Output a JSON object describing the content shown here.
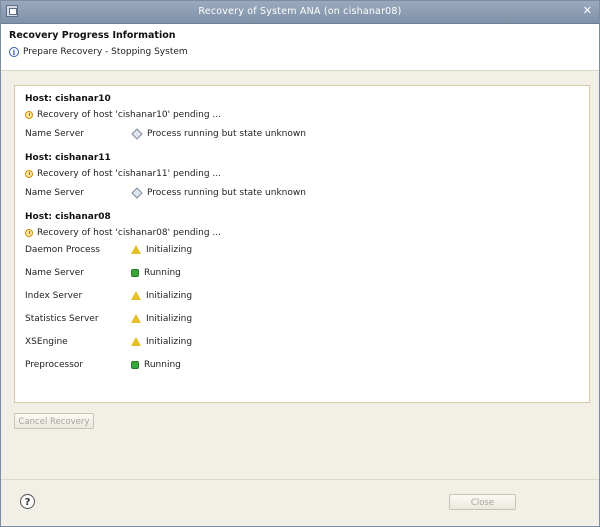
{
  "window": {
    "title": "Recovery of System ANA  (on cishanar08)"
  },
  "header": {
    "title": "Recovery Progress Information",
    "status": "Prepare Recovery - Stopping System"
  },
  "hosts": [
    {
      "title": "Host: cishanar10",
      "pending": "Recovery of host 'cishanar10' pending ...",
      "components": [
        {
          "name": "Name Server",
          "status": "Process running but state unknown",
          "icon": "diamond-icon"
        }
      ]
    },
    {
      "title": "Host: cishanar11",
      "pending": "Recovery of host 'cishanar11' pending ...",
      "components": [
        {
          "name": "Name Server",
          "status": "Process running but state unknown",
          "icon": "diamond-icon"
        }
      ]
    },
    {
      "title": "Host: cishanar08",
      "pending": "Recovery of host 'cishanar08' pending ...",
      "components": [
        {
          "name": "Daemon Process",
          "status": "Initializing",
          "icon": "warning-icon"
        },
        {
          "name": "Name Server",
          "status": "Running",
          "icon": "running-icon"
        },
        {
          "name": "Index Server",
          "status": "Initializing",
          "icon": "warning-icon"
        },
        {
          "name": "Statistics Server",
          "status": "Initializing",
          "icon": "warning-icon"
        },
        {
          "name": "XSEngine",
          "status": "Initializing",
          "icon": "warning-icon"
        },
        {
          "name": "Preprocessor",
          "status": "Running",
          "icon": "running-icon"
        }
      ]
    }
  ],
  "buttons": {
    "cancel": "Cancel Recovery",
    "close": "Close",
    "help": "?"
  },
  "colors": {
    "titlebar": "#8a9bb1",
    "warning": "#e6c02a",
    "running": "#3aa63a"
  }
}
